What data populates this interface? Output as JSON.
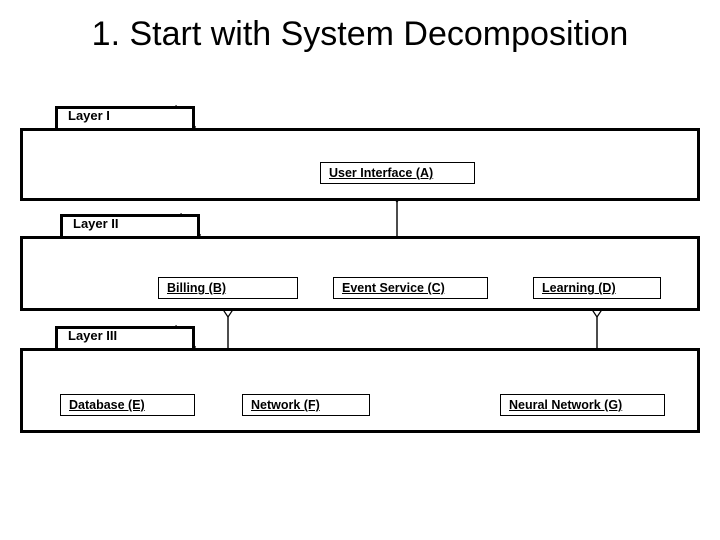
{
  "title": "1. Start with System Decomposition",
  "layers": {
    "l1": "Layer I",
    "l2": "Layer II",
    "l3": "Layer III"
  },
  "nodes": {
    "a": "User Interface (A)",
    "b": "Billing (B)",
    "c": "Event Service (C)",
    "d": "Learning (D)",
    "e": "Database (E)",
    "f": "Network (F)",
    "g": "Neural Network (G)"
  },
  "edges": [
    {
      "from": "A",
      "to": [
        "B",
        "C",
        "D"
      ],
      "type": "aggregation"
    },
    {
      "from": "B",
      "to": [
        "E",
        "F"
      ],
      "type": "aggregation"
    },
    {
      "from": "D",
      "to": [
        "G"
      ],
      "type": "aggregation"
    }
  ]
}
